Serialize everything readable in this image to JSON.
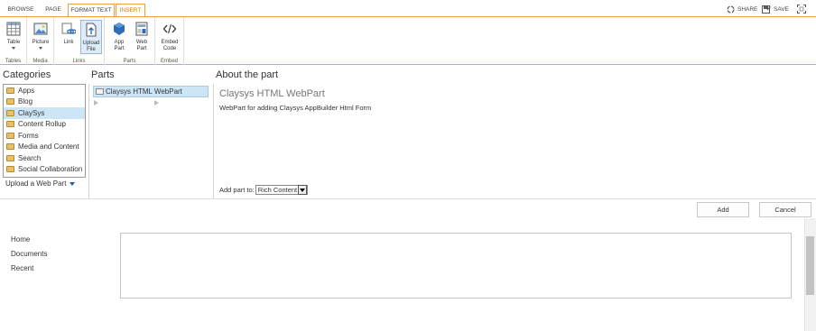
{
  "tabs": {
    "browse": "BROWSE",
    "page": "PAGE",
    "format_text": "FORMAT TEXT",
    "insert": "INSERT"
  },
  "top_actions": {
    "share": "SHARE",
    "save": "SAVE"
  },
  "ribbon": {
    "groups": {
      "tables": "Tables",
      "media": "Media",
      "links": "Links",
      "parts": "Parts",
      "embed": "Embed"
    },
    "buttons": {
      "table": "Table",
      "picture": "Picture",
      "link": "Link",
      "upload_file_1": "Upload",
      "upload_file_2": "File",
      "app_part_1": "App",
      "app_part_2": "Part",
      "web_part_1": "Web",
      "web_part_2": "Part",
      "embed_code_1": "Embed",
      "embed_code_2": "Code"
    }
  },
  "panels": {
    "categories_header": "Categories",
    "parts_header": "Parts",
    "about_header": "About the part"
  },
  "categories": [
    {
      "label": "Apps"
    },
    {
      "label": "Blog"
    },
    {
      "label": "ClaySys"
    },
    {
      "label": "Content Rollup"
    },
    {
      "label": "Forms"
    },
    {
      "label": "Media and Content"
    },
    {
      "label": "Search"
    },
    {
      "label": "Social Collaboration"
    }
  ],
  "upload_web_part": "Upload a Web Part",
  "parts": {
    "selected": "Claysys HTML WebPart"
  },
  "about": {
    "title": "Claysys HTML WebPart",
    "description": "WebPart for adding Claysys AppBuilder Html Form",
    "add_part_label": "Add part to:",
    "add_part_value": "Rich Content"
  },
  "actions": {
    "add": "Add",
    "cancel": "Cancel"
  },
  "nav": {
    "home": "Home",
    "documents": "Documents",
    "recent": "Recent"
  },
  "colors": {
    "accent": "#e6a13a",
    "selection": "#cde6f7",
    "insert_tab": "#e07b00"
  }
}
